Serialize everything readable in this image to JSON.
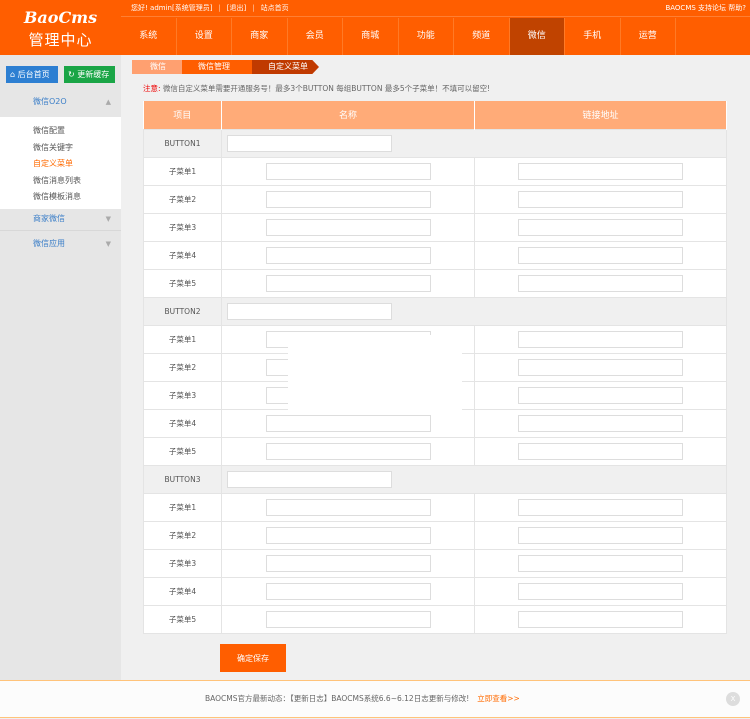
{
  "logo": {
    "brand": "BaoCms",
    "subtitle": "管理中心"
  },
  "topbar": {
    "greeting": "您好! admin[系统管理员]",
    "logout": "[退出]",
    "site_home": "站点首页",
    "right_links": [
      "BAOCMS",
      "支持论坛",
      "帮助?"
    ]
  },
  "nav": {
    "items": [
      "系统",
      "设置",
      "商家",
      "会员",
      "商城",
      "功能",
      "频道",
      "微信",
      "手机",
      "运营"
    ],
    "active": "微信"
  },
  "sidebar": {
    "home_button": "后台首页",
    "cache_button": "更新缓存",
    "sections": [
      {
        "label": "微信O2O",
        "expanded": true,
        "items": [
          "微信配置",
          "微信关键字",
          "自定义菜单",
          "微信消息列表",
          "微信模板消息"
        ],
        "active": "自定义菜单"
      },
      {
        "label": "商家微信",
        "expanded": false
      },
      {
        "label": "微信应用",
        "expanded": false
      }
    ]
  },
  "breadcrumb": [
    "微信",
    "微信管理",
    "自定义菜单"
  ],
  "notice": {
    "label": "注意:",
    "text": "微信自定义菜单需要开通服务号！最多3个BUTTON 每组BUTTON 最多5个子菜单！不填可以留空!"
  },
  "table": {
    "headers": [
      "项目",
      "名称",
      "链接地址"
    ],
    "groups": [
      {
        "button": "BUTTON1",
        "subs": [
          "子菜单1",
          "子菜单2",
          "子菜单3",
          "子菜单4",
          "子菜单5"
        ]
      },
      {
        "button": "BUTTON2",
        "subs": [
          "子菜单1",
          "子菜单2",
          "子菜单3",
          "子菜单4",
          "子菜单5"
        ]
      },
      {
        "button": "BUTTON3",
        "subs": [
          "子菜单1",
          "子菜单2",
          "子菜单3",
          "子菜单4",
          "子菜单5"
        ]
      }
    ]
  },
  "save_label": "确定保存",
  "footer": {
    "text": "BAOCMS官方最新动态：【更新日志】BAOCMS系统6.6~6.12日志更新与修改!",
    "link": "立即查看>>",
    "close": "X"
  },
  "colors": {
    "brand": "#ff5e00",
    "nav_active": "#c04300",
    "table_header": "#ffab78"
  }
}
